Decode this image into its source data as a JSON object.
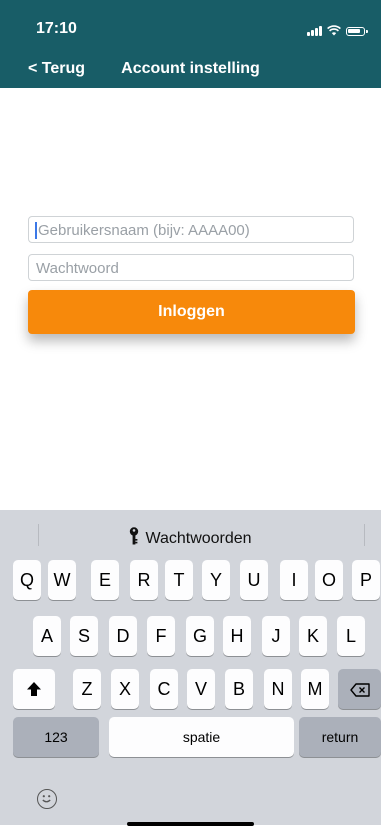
{
  "status_bar": {
    "time": "17:10"
  },
  "nav": {
    "back_label": "< Terug",
    "title": "Account instelling"
  },
  "form": {
    "username_placeholder": "Gebruikersnaam (bijv: AAAA00)",
    "password_placeholder": "Wachtwoord",
    "login_label": "Inloggen"
  },
  "colors": {
    "header_bg": "#185d67",
    "accent": "#f7890b"
  },
  "keyboard": {
    "suggestion": "Wachtwoorden",
    "row1": [
      "Q",
      "W",
      "E",
      "R",
      "T",
      "Y",
      "U",
      "I",
      "O",
      "P"
    ],
    "row2": [
      "A",
      "S",
      "D",
      "F",
      "G",
      "H",
      "J",
      "K",
      "L"
    ],
    "row3": [
      "Z",
      "X",
      "C",
      "V",
      "B",
      "N",
      "M"
    ],
    "shift_icon": "shift-arrow-up-icon",
    "delete_icon": "backspace-icon",
    "numbers_label": "123",
    "space_label": "spatie",
    "return_label": "return",
    "emoji_icon": "emoji-smiley-icon"
  }
}
